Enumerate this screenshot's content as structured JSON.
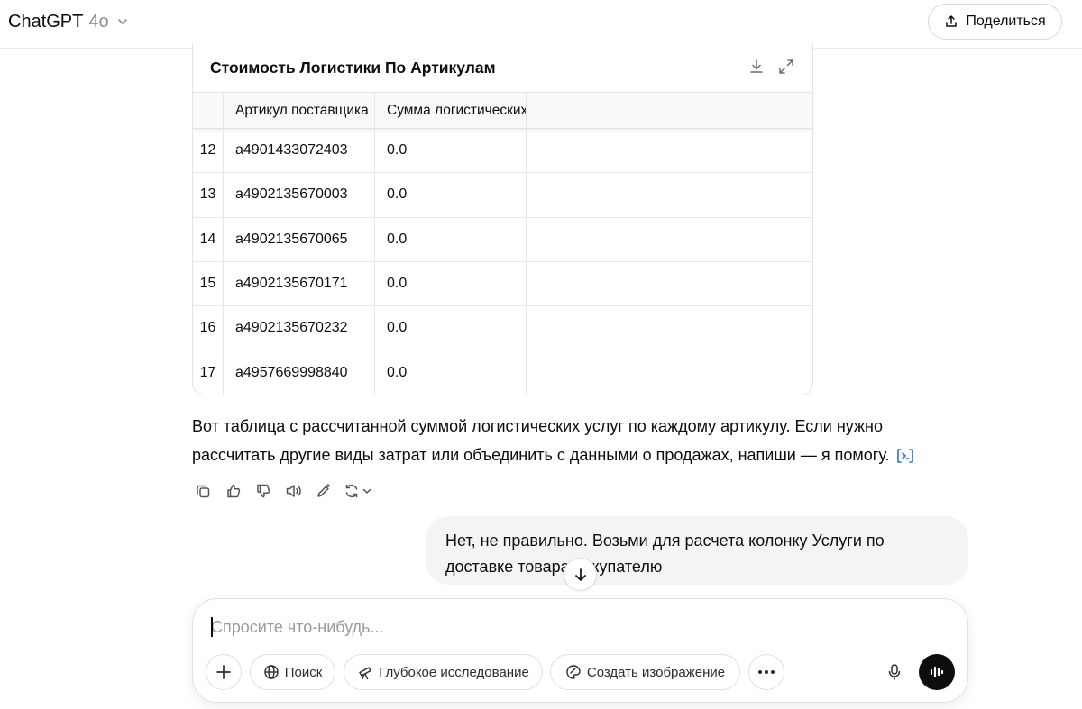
{
  "header": {
    "model_name": "ChatGPT",
    "model_version": "4o",
    "share_label": "Поделиться"
  },
  "table_card": {
    "title": "Стоимость Логистики По Артикулам",
    "columns": [
      "Артикул поставщика",
      "Сумма логистических услуг"
    ],
    "rows": [
      {
        "index": "12",
        "article": "a4901433072403",
        "sum": "0.0"
      },
      {
        "index": "13",
        "article": "a4902135670003",
        "sum": "0.0"
      },
      {
        "index": "14",
        "article": "a4902135670065",
        "sum": "0.0"
      },
      {
        "index": "15",
        "article": "a4902135670171",
        "sum": "0.0"
      },
      {
        "index": "16",
        "article": "a4902135670232",
        "sum": "0.0"
      },
      {
        "index": "17",
        "article": "a4957669998840",
        "sum": "0.0"
      }
    ]
  },
  "assistant_message": {
    "text": "Вот таблица с рассчитанной суммой логистических услуг по каждому артикулу. Если нужно рассчитать другие виды затрат или объединить с данными о продажах, напиши — я помогу."
  },
  "user_message": {
    "text": "Нет, не правильно. Возьми для расчета колонку Услуги по доставке товара покупателю"
  },
  "composer": {
    "placeholder": "Спросите что-нибудь...",
    "tools": {
      "search": "Поиск",
      "deep_research": "Глубокое исследование",
      "create_image": "Создать изображение"
    }
  },
  "colors": {
    "text": "#0d0d0d",
    "muted": "#8f8f8f",
    "bubble": "#f4f4f4",
    "border": "#e0e0e0",
    "citation": "#2f6fd1",
    "voice_button": "#0d0d0d"
  }
}
